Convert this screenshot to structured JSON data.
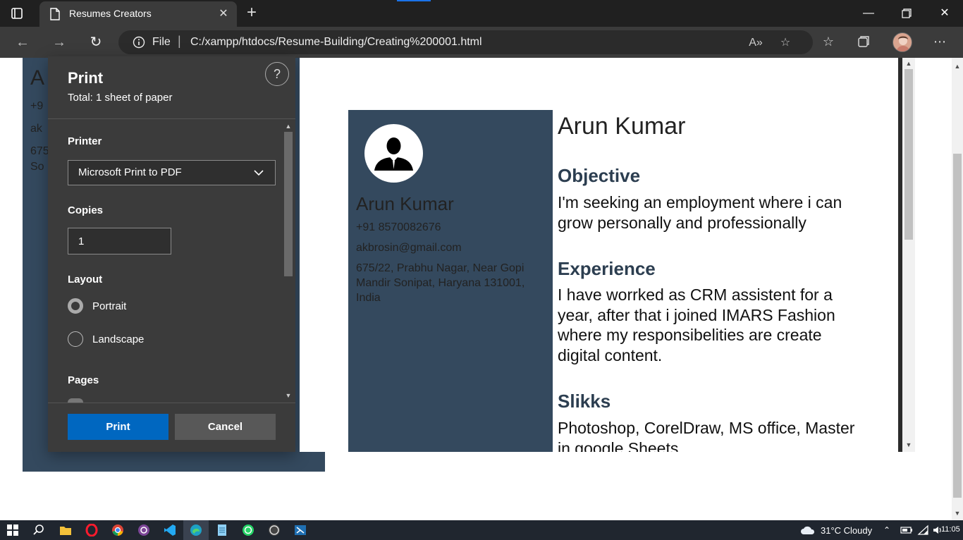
{
  "browser": {
    "tab_title": "Resumes Creators",
    "address_scheme": "File",
    "address_url": "C:/xampp/htdocs/Resume-Building/Creating%200001.html"
  },
  "print_dialog": {
    "title": "Print",
    "total": "Total: 1 sheet of paper",
    "help": "?",
    "printer_label": "Printer",
    "printer_value": "Microsoft Print to PDF",
    "copies_label": "Copies",
    "copies_value": "1",
    "layout_label": "Layout",
    "layout_options": [
      "Portrait",
      "Landscape"
    ],
    "layout_selected": "Portrait",
    "pages_label": "Pages",
    "print_button": "Print",
    "cancel_button": "Cancel"
  },
  "background_page": {
    "name_initial": "A",
    "phone_fragment": "+9",
    "email_fragment": "ak",
    "address_fragment_1": "675",
    "address_fragment_2": "So"
  },
  "resume": {
    "name": "Arun Kumar",
    "phone": "+91 8570082676",
    "email": "akbrosin@gmail.com",
    "address": "675/22, Prabhu Nagar, Near Gopi Mandir Sonipat, Haryana 131001, India",
    "objective_heading": "Objective",
    "objective_text": "I'm seeking an employment where i can grow personally and professionally",
    "experience_heading": "Experience",
    "experience_text": "I have worrked as CRM assistent for a year, after that i joined IMARS Fashion where my responsibelities are create digital content.",
    "skills_heading": "Slikks",
    "skills_text": "Photoshop, CorelDraw, MS office, Master in google Sheets"
  },
  "taskbar": {
    "weather": "31°C  Cloudy",
    "time": "11:05"
  },
  "colors": {
    "resume_sidebar": "#34495e",
    "print_button": "#0067c0",
    "dialog_bg": "#3b3b3b"
  }
}
